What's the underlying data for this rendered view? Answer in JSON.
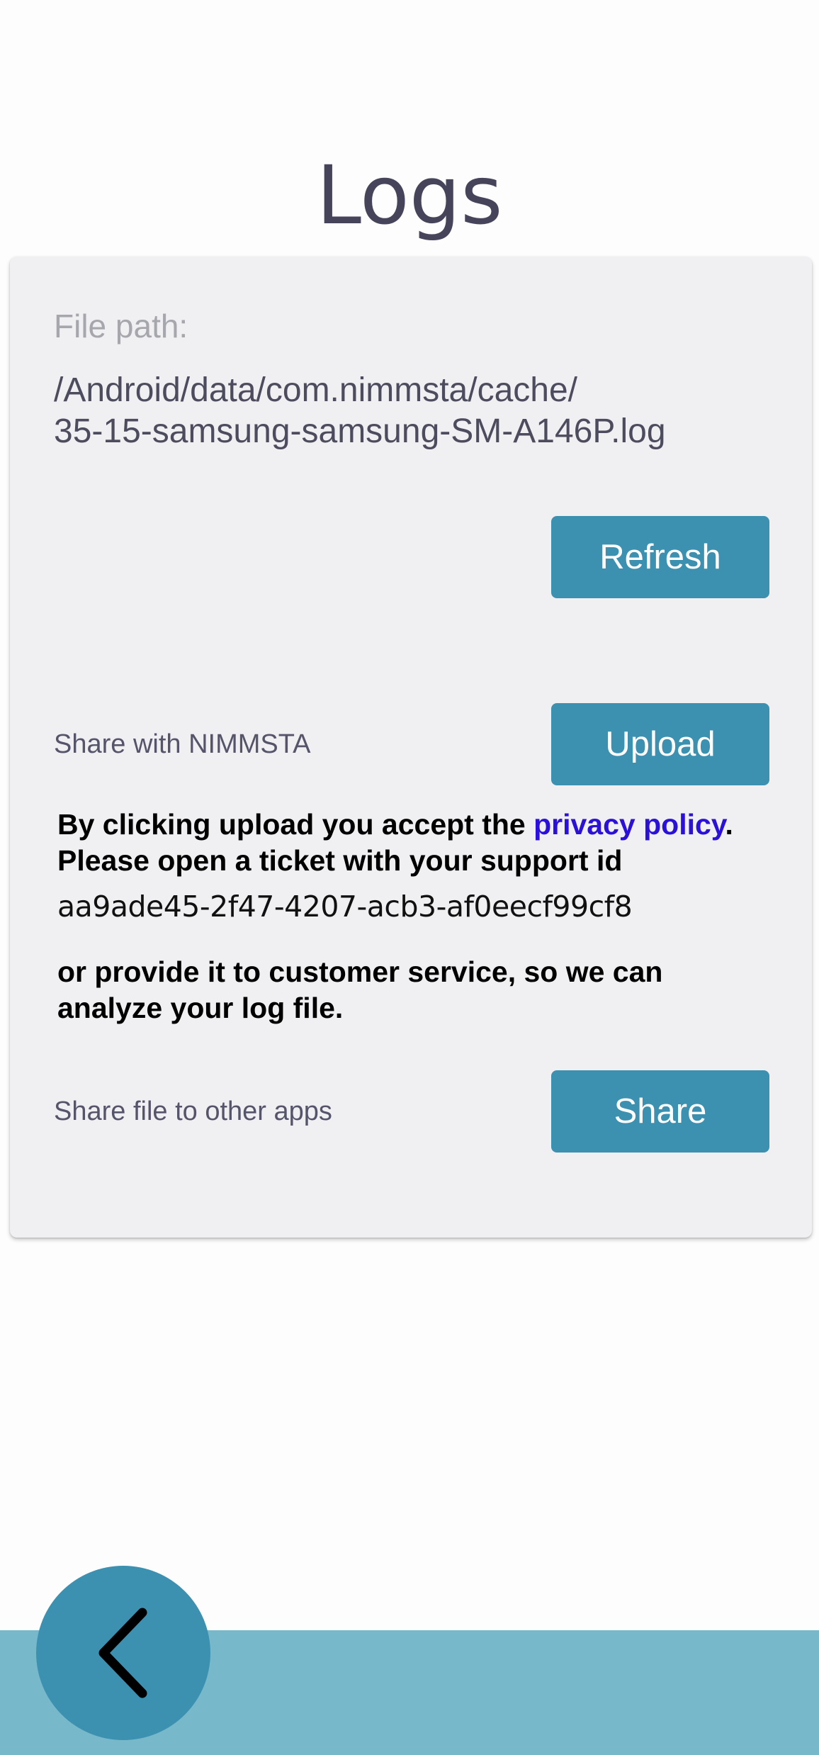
{
  "header": {
    "title": "Logs"
  },
  "card": {
    "file_path_label": "File path:",
    "file_path_line1": "/Android/data/com.nimmsta/cache/",
    "file_path_line2": "35-15-samsung-samsung-SM-A146P.log",
    "refresh_label": "Refresh",
    "share_with_label": "Share with NIMMSTA",
    "upload_label": "Upload",
    "notice": {
      "prefix": "By clicking upload you accept the ",
      "link_text": "privacy policy",
      "suffix": ". Please open a ticket with your support id",
      "support_id": "aa9ade45-2f47-4207-acb3-af0eecf99cf8",
      "closing": "or provide it to customer service, so we can analyze your log file."
    },
    "share_file_label": "Share file to other apps",
    "share_label": "Share"
  },
  "navigation": {
    "back_icon": "chevron-left-icon"
  },
  "colors": {
    "accent": "#3d91b0",
    "bottom_bar": "#77b8cb",
    "card_background": "#f0f0f3",
    "link": "#2a10d8",
    "title": "#45445a"
  }
}
